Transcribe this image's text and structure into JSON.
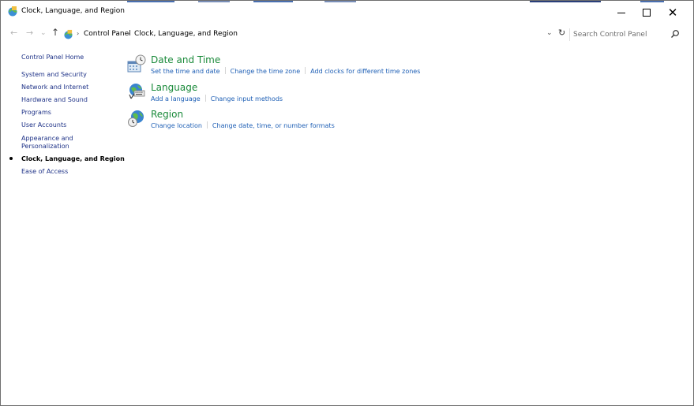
{
  "window": {
    "title": "Clock, Language, and Region"
  },
  "address_bar": {
    "breadcrumbs": [
      "Control Panel",
      "Clock, Language, and Region"
    ],
    "search_placeholder": "Search Control Panel"
  },
  "sidebar": {
    "items": [
      {
        "label": "Control Panel Home"
      },
      {
        "label": "System and Security"
      },
      {
        "label": "Network and Internet"
      },
      {
        "label": "Hardware and Sound"
      },
      {
        "label": "Programs"
      },
      {
        "label": "User Accounts"
      },
      {
        "label": "Appearance and Personalization"
      },
      {
        "label": "Clock, Language, and Region",
        "current": true
      },
      {
        "label": "Ease of Access"
      }
    ]
  },
  "categories": [
    {
      "title": "Date and Time",
      "icon": "date-time-icon",
      "links": [
        "Set the time and date",
        "Change the time zone",
        "Add clocks for different time zones"
      ]
    },
    {
      "title": "Language",
      "icon": "language-icon",
      "links": [
        "Add a language",
        "Change input methods"
      ]
    },
    {
      "title": "Region",
      "icon": "region-icon",
      "links": [
        "Change location",
        "Change date, time, or number formats"
      ]
    }
  ],
  "colors": {
    "category_title": "#1a8a3a",
    "link": "#1e5fb5",
    "sidebar_link": "#1e3287"
  }
}
